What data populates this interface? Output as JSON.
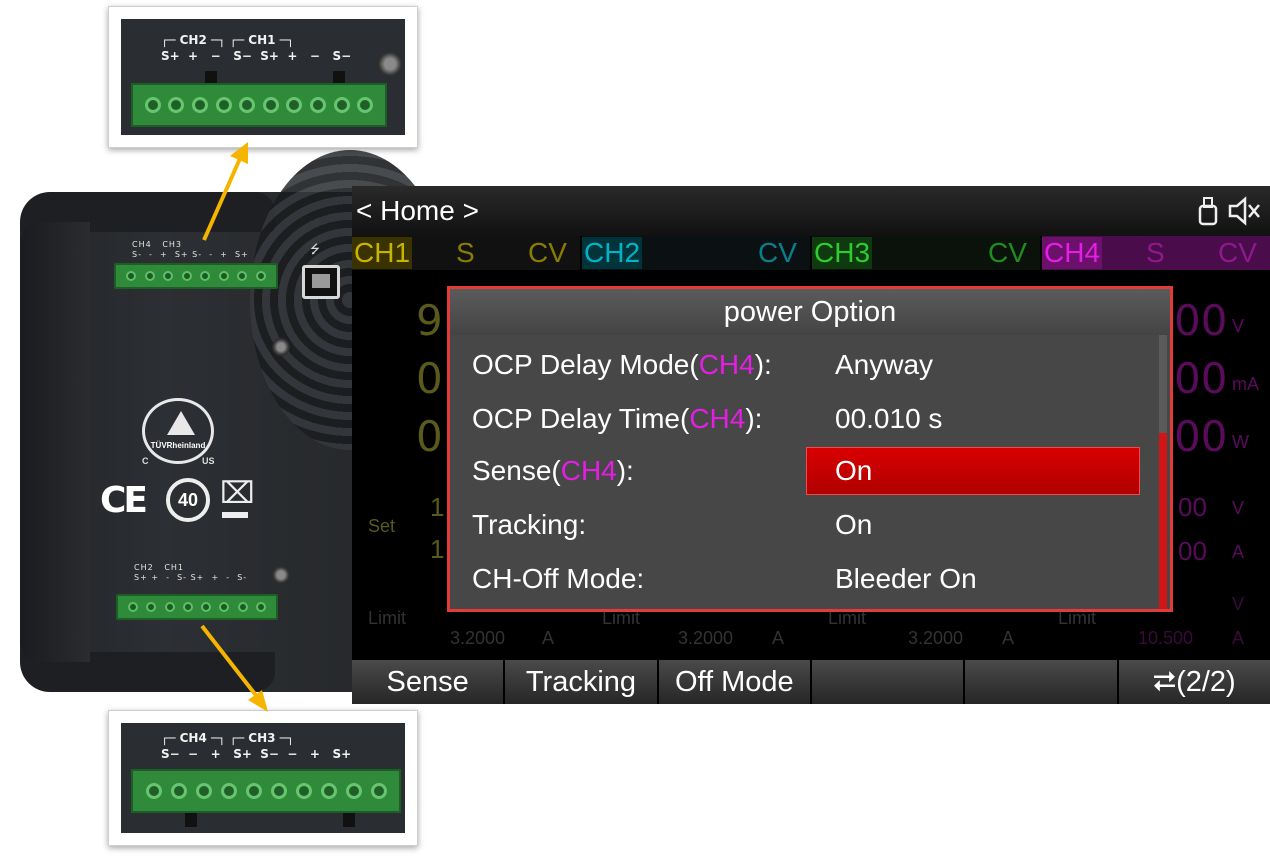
{
  "screen": {
    "breadcrumb": "< Home >",
    "icons": [
      "usb-drive-icon",
      "speaker-muted-icon"
    ],
    "channels": [
      {
        "name": "CH1",
        "sense": "S",
        "mode": "CV",
        "color": "#c8b400"
      },
      {
        "name": "CH2",
        "sense": "",
        "mode": "CV",
        "color": "#00b4c8"
      },
      {
        "name": "CH3",
        "sense": "",
        "mode": "CV",
        "color": "#2ecc2e"
      },
      {
        "name": "CH4",
        "sense": "S",
        "mode": "CV",
        "color": "#e41ee4"
      }
    ],
    "background": {
      "ch1_values": [
        "9.",
        "0.",
        "0."
      ],
      "ch4_values": [
        "00",
        "00",
        "00"
      ],
      "ch4_units": [
        "V",
        "mA",
        "W"
      ],
      "set_label": "Set",
      "set_values": [
        "1",
        "1"
      ],
      "set_right_values": [
        "00",
        "00"
      ],
      "set_right_units": [
        "V",
        "A"
      ],
      "limit_label": "Limit",
      "limits": [
        "3.2000",
        "3.2000",
        "3.2000",
        "10.500"
      ],
      "limit_units": [
        "A",
        "A",
        "A",
        "A"
      ],
      "limit_right_units": [
        "V",
        "A"
      ]
    },
    "dialog": {
      "title": "power Option",
      "options": [
        {
          "label_prefix": "OCP Delay Mode(",
          "channel": "CH4",
          "label_suffix": "):",
          "value": "Anyway",
          "selected": false
        },
        {
          "label_prefix": "OCP Delay Time(",
          "channel": "CH4",
          "label_suffix": "):",
          "value": "00.010 s",
          "selected": false
        },
        {
          "label_prefix": "Sense(",
          "channel": "CH4",
          "label_suffix": "):",
          "value": "On",
          "selected": true
        },
        {
          "label_prefix": "Tracking:",
          "channel": "",
          "label_suffix": "",
          "value": "On",
          "selected": false
        },
        {
          "label_prefix": "CH-Off Mode:",
          "channel": "",
          "label_suffix": "",
          "value": "Bleeder On",
          "selected": false
        }
      ]
    },
    "softkeys": [
      "Sense",
      "Tracking",
      "Off Mode",
      "",
      "",
      "⮂(2/2)"
    ]
  },
  "device": {
    "top_terminal_label": "CH4   CH3",
    "top_terminal_pins": "S-  -  +  S+ S-  -  +  S+",
    "bottom_terminal_label": "CH2   CH1",
    "bottom_terminal_pins": "S+ +  -  S- S+  +  -  S-",
    "tuv_text": "TÜVRheinland",
    "c_mark": "C",
    "us_mark": "US",
    "ce_mark": "CE",
    "forty_mark": "40"
  },
  "callouts": {
    "top": {
      "group_label": "┌─ CH2 ─┐ ┌─ CH1 ─┐",
      "pins": "S+  +   −   S−  S+  +   −   S−"
    },
    "bottom": {
      "group_label": "┌─ CH4 ─┐ ┌─ CH3 ─┐",
      "pins": "S−  −   +   S+  S−  −   +   S+"
    }
  },
  "colors": {
    "highlight": "#e41ee4",
    "selected_bg": "#c80000",
    "dialog_border": "#e33a3a",
    "arrow": "#f5b400"
  }
}
